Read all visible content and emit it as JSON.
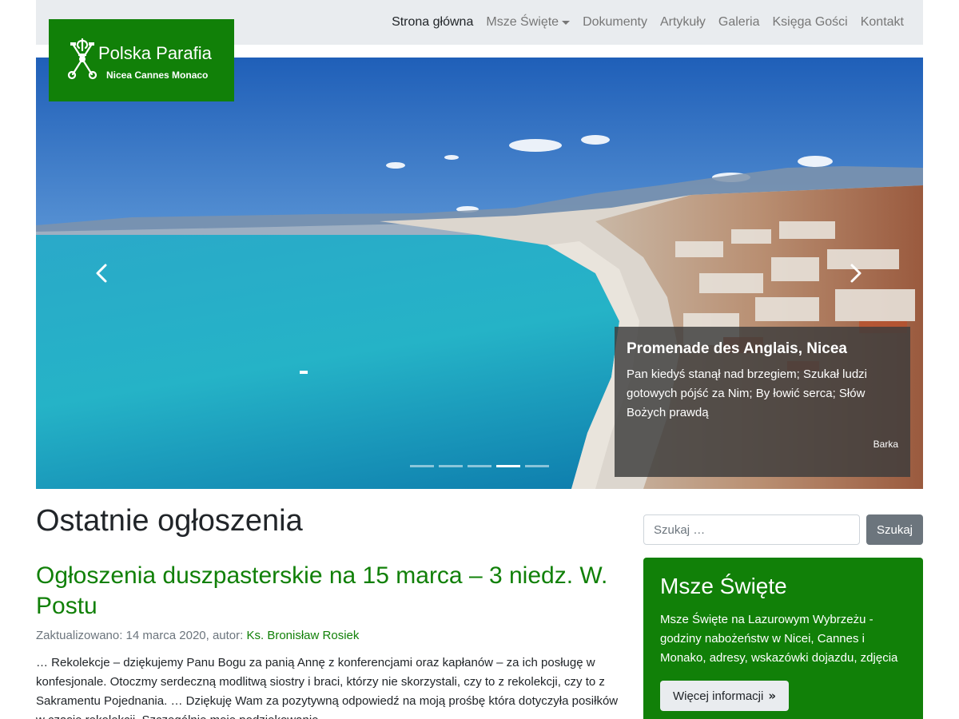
{
  "nav": {
    "items": [
      {
        "label": "Strona główna",
        "active": true
      },
      {
        "label": "Msze Święte",
        "dropdown": true
      },
      {
        "label": "Dokumenty"
      },
      {
        "label": "Artykuły"
      },
      {
        "label": "Galeria"
      },
      {
        "label": "Księga Gości"
      },
      {
        "label": "Kontakt"
      }
    ]
  },
  "logo": {
    "title": "Polska Parafia",
    "subtitle": "Nicea Cannes Monaco",
    "emblem_icon": "papal-keys-icon"
  },
  "carousel": {
    "prev_icon": "chevron-left-icon",
    "next_icon": "chevron-right-icon",
    "slide_count": 5,
    "active_slide": 4,
    "caption": {
      "title": "Promenade des Anglais, Nicea",
      "text": "Pan kiedyś stanął nad brzegiem; Szukał ludzi gotowych pójść za Nim; By łowić serca; Słów Bożych prawdą",
      "source": "Barka"
    }
  },
  "main": {
    "heading": "Ostatnie ogłoszenia",
    "post": {
      "title": "Ogłoszenia duszpasterskie na 15 marca – 3 niedz. W. Postu",
      "meta_prefix": "Zaktualizowano: 14 marca 2020, autor: ",
      "author": "Ks. Bronisław Rosiek",
      "excerpt": "… Rekolekcje – dziękujemy Panu Bogu za panią Annę z konferencjami oraz kapłanów –  za ich posługę w konfesjonale. Otoczmy serdeczną modlitwą siostry i braci, którzy nie skorzystali, czy to z rekolekcji, czy to z Sakramentu Pojednania. … Dziękuję Wam za pozytywną odpowiedź  na moją prośbę która dotyczyła posiłków w czasie rekolekcji. Szczególnie moje podziękowanie"
    }
  },
  "sidebar": {
    "search": {
      "placeholder": "Szukaj …",
      "button": "Szukaj"
    },
    "widget": {
      "title": "Msze Święte",
      "text": "Msze Święte na Lazurowym Wybrzeżu - godziny nabożeństw w Nicei, Cannes i Monako, adresy, wskazówki dojazdu, zdjęcia",
      "button": "Więcej informacji",
      "button_icon": "double-chevron-right-icon"
    }
  },
  "colors": {
    "brand_green": "#118008",
    "navbar_bg": "#e9ecef",
    "search_button_bg": "#6c757d"
  }
}
